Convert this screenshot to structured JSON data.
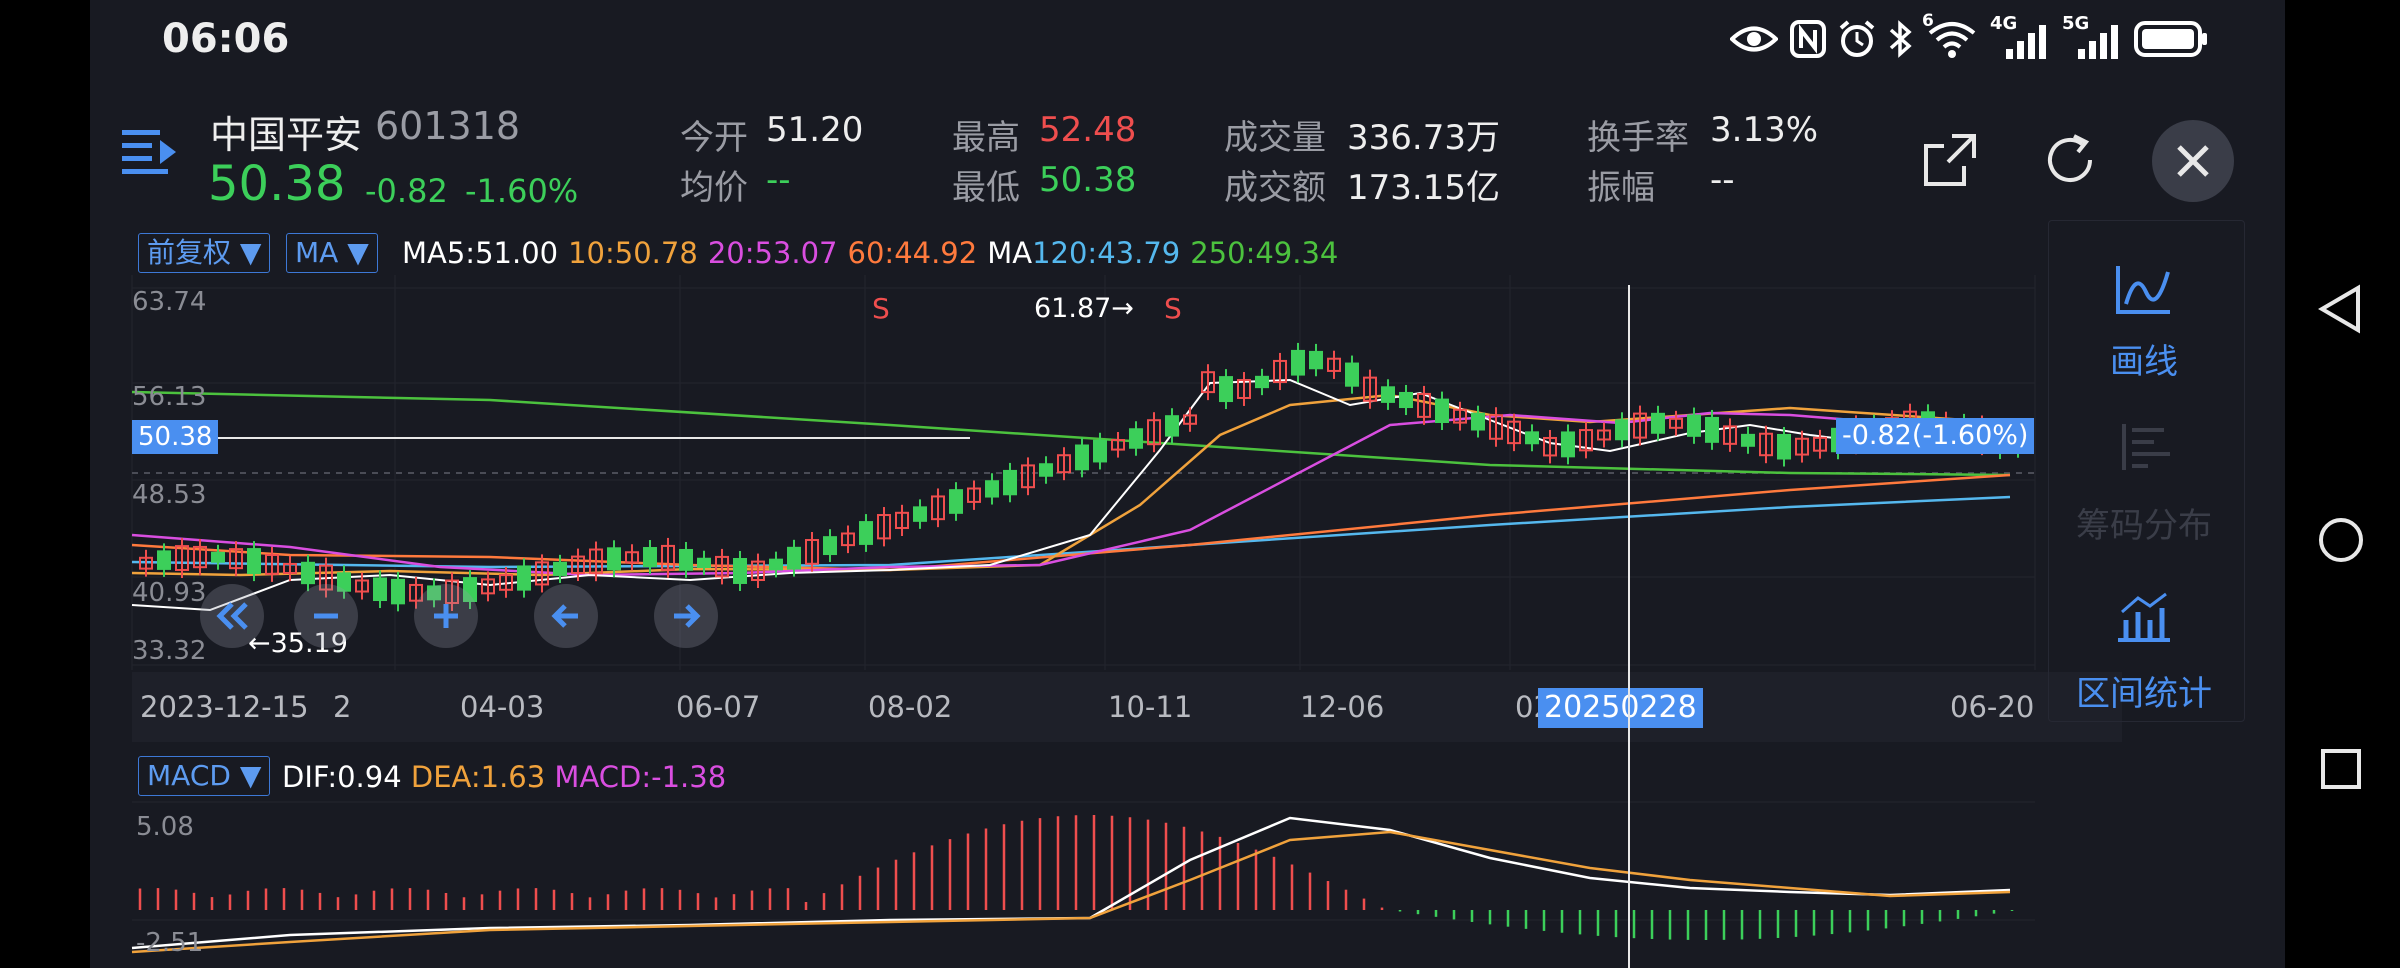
{
  "status_bar": {
    "time": "06:06",
    "icons": [
      "eye-icon",
      "nfc-icon",
      "alarm-icon",
      "bluetooth-icon",
      "wifi-icon",
      "signal-4g-icon",
      "signal-5g-icon",
      "battery-icon"
    ],
    "wifi_tag": "6",
    "net1": "4G",
    "net2": "5G"
  },
  "stock": {
    "name": "中国平安",
    "code": "601318",
    "price": "50.38",
    "change": "-0.82",
    "change_pct": "-1.60%"
  },
  "stats": {
    "open_label": "今开",
    "open": "51.20",
    "avg_label": "均价",
    "avg": "--",
    "high_label": "最高",
    "high": "52.48",
    "low_label": "最低",
    "low": "50.38",
    "volume_label": "成交量",
    "volume": "336.73万",
    "amount_label": "成交额",
    "amount": "173.15亿",
    "turnover_label": "换手率",
    "turnover": "3.13%",
    "amplitude_label": "振幅",
    "amplitude": "--"
  },
  "toolbar": {
    "icons": [
      "share-icon",
      "refresh-icon",
      "close-icon"
    ]
  },
  "ma_bar": {
    "adjust": "前复权 ▼",
    "indicator": "MA ▼",
    "ma5": "MA5:51.00",
    "ma10": "10:50.78",
    "ma20": "20:53.07",
    "ma60": "60:44.92",
    "ma120_prefix": "MA",
    "ma120": "120:43.79",
    "ma250": "250:49.34"
  },
  "kline": {
    "y_ticks": [
      "63.74",
      "56.13",
      "48.53",
      "40.93",
      "33.32"
    ],
    "current_price_tag": "50.38",
    "change_tag": "-0.82(-1.60%)",
    "high_note": "61.87→",
    "low_note": "←35.19",
    "sell_marks": [
      "S",
      "S"
    ],
    "x_labels": [
      "2023-12-15",
      "2",
      "04-03",
      "06-07",
      "08-02",
      "10-11",
      "12-06",
      "02",
      "06-20"
    ],
    "crosshair_date": "20250228"
  },
  "macd": {
    "indicator": "MACD ▼",
    "dif": "DIF:0.94",
    "dea": "DEA:1.63",
    "macd": "MACD:-1.38",
    "y_max": "5.08",
    "y_min": "-2.51"
  },
  "side_panel": {
    "draw": "画线",
    "chips": "筹码分布",
    "range_stats": "区间统计"
  },
  "controls": [
    "rewind-icon",
    "zoom-out-icon",
    "zoom-in-icon",
    "arrow-left-icon",
    "arrow-right-icon"
  ],
  "nav_bar": [
    "back-icon",
    "home-icon",
    "recents-icon"
  ],
  "colors": {
    "up": "#ef4e4e",
    "down": "#3ccf5a",
    "accent": "#4a8ff0",
    "ma5": "#ffffff",
    "ma10": "#f0a23c",
    "ma20": "#d94ee0",
    "ma60": "#ff7a3d",
    "ma120": "#55b8ee",
    "ma250": "#4cc23e"
  }
}
